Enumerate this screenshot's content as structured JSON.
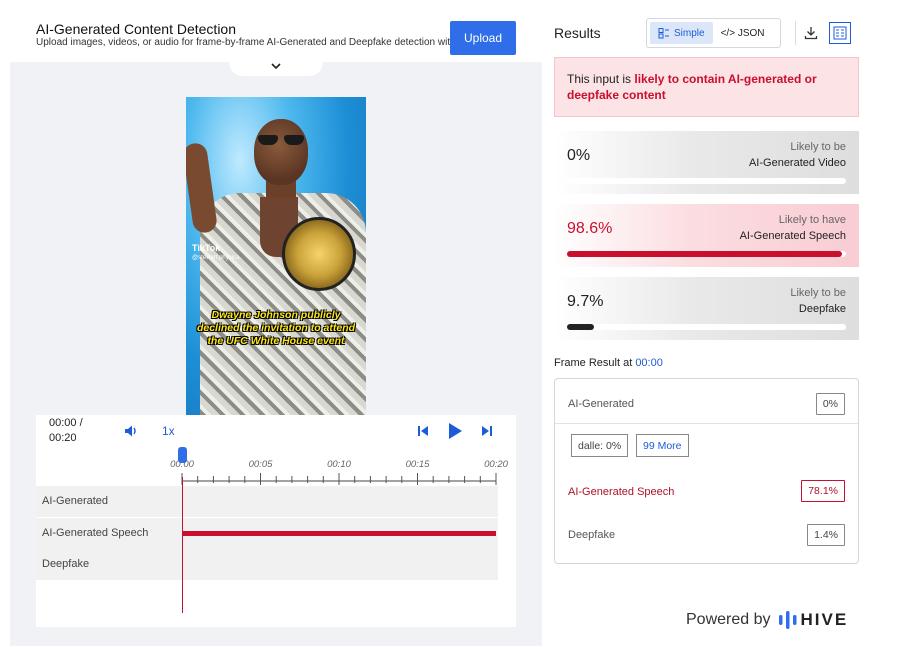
{
  "header": {
    "title": "AI-Generated Content Detection",
    "subtitle": "Upload images, videos, or audio for frame-by-frame AI-Generated and Deepfake detection with...",
    "upload_label": "Upload"
  },
  "video": {
    "watermark": "TikTok",
    "handle": "@stewart.physica",
    "caption": "Dwayne Johnson publicly declined the invitation to attend the UFC White House event"
  },
  "player": {
    "time_current": "00:00 /",
    "time_total": "00:20",
    "speed": "1x",
    "volume_icon": "volume-icon",
    "prev_icon": "skip-back-icon",
    "play_icon": "play-icon",
    "next_icon": "skip-forward-icon"
  },
  "timeline": {
    "ticks": [
      "00:00",
      "00:05",
      "00:10",
      "00:15",
      "00:20"
    ],
    "duration_seconds": 20,
    "playhead_seconds": 0,
    "tracks": [
      {
        "label": "AI-Generated",
        "active": false
      },
      {
        "label": "AI-Generated Speech",
        "active": true
      },
      {
        "label": "Deepfake",
        "active": false
      }
    ]
  },
  "results": {
    "title": "Results",
    "view_simple": "Simple",
    "view_json": "</> JSON",
    "download_icon": "download-icon",
    "layout_icon": "layout-icon",
    "verdict_prefix": "This input is ",
    "verdict_emphasis": "likely to contain AI-generated or deepfake content",
    "cards": [
      {
        "pct": "0%",
        "value": 0,
        "line1": "Likely to be",
        "line2": "AI-Generated Video",
        "flagged": false
      },
      {
        "pct": "98.6%",
        "value": 0.986,
        "line1": "Likely to have",
        "line2": "AI-Generated Speech",
        "flagged": true
      },
      {
        "pct": "9.7%",
        "value": 0.097,
        "line1": "Likely to be",
        "line2": "Deepfake",
        "flagged": false
      }
    ]
  },
  "frame": {
    "title_prefix": "Frame Result at ",
    "time": "00:00",
    "rows": {
      "ai_generated": {
        "label": "AI-Generated",
        "value": "0%"
      },
      "chip_dalle": "dalle: 0%",
      "chip_more": "99 More",
      "speech": {
        "label": "AI-Generated Speech",
        "value": "78.1%"
      },
      "deepfake": {
        "label": "Deepfake",
        "value": "1.4%"
      }
    }
  },
  "footer": {
    "powered_by": "Powered by",
    "brand": "HIVE"
  },
  "colors": {
    "accent": "#2f6ee8",
    "alert": "#c8102e",
    "link": "#1f5bd8"
  }
}
